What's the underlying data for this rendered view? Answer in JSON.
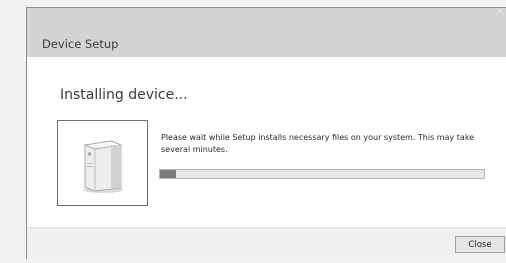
{
  "window": {
    "title": "Device Setup",
    "close_glyph": "×"
  },
  "main": {
    "heading": "Installing device...",
    "message": "Please wait while Setup installs necessary files on your system. This may take several minutes.",
    "device_icon": "printer-device-icon",
    "progress_fraction": 0.05
  },
  "footer": {
    "close_label": "Close"
  },
  "colors": {
    "titlebar": "#d4d4d4",
    "progress_fill": "#7a7a7a",
    "progress_track": "#e6e6e6"
  }
}
